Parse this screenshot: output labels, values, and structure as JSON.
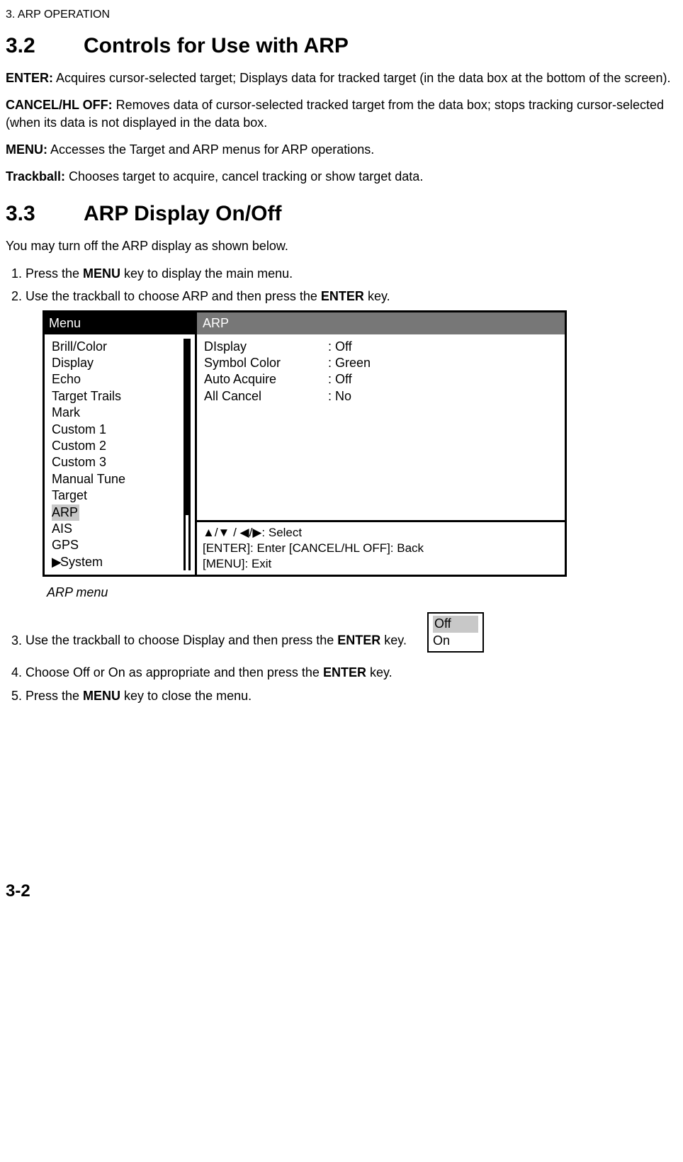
{
  "header": {
    "chapter": "3. ARP OPERATION"
  },
  "section32": {
    "num": "3.2",
    "title": "Controls for Use with ARP",
    "p_enter_label": "ENTER:",
    "p_enter_text": " Acquires cursor-selected target; Displays data for tracked target (in the data box at the bottom of the screen).",
    "p_cancel_label": "CANCEL/HL OFF:",
    "p_cancel_text": " Removes data of cursor-selected tracked target from the data box; stops tracking cursor-selected (when its data is not displayed in the data box.",
    "p_menu_label": "MENU:",
    "p_menu_text": " Accesses the Target and ARP menus for ARP operations.",
    "p_trackball_label": "Trackball:",
    "p_trackball_text": " Chooses target to acquire, cancel tracking or show target data."
  },
  "section33": {
    "num": "3.3",
    "title": "ARP Display On/Off",
    "intro": "You may turn off the ARP display as shown below.",
    "step1_a": "Press the ",
    "step1_b": "MENU",
    "step1_c": " key to display the main menu.",
    "step2_a": "Use the trackball to choose ARP and then press the ",
    "step2_b": "ENTER",
    "step2_c": " key.",
    "step3_a": "Use the trackball to choose Display and then press the ",
    "step3_b": "ENTER",
    "step3_c": " key.",
    "step4_a": "Choose Off or On as appropriate and then press the ",
    "step4_b": "ENTER",
    "step4_c": " key.",
    "step5_a": "Press the ",
    "step5_b": "MENU",
    "step5_c": " key to close the menu."
  },
  "menu_figure": {
    "left_title": "Menu",
    "items": {
      "i0": "Brill/Color",
      "i1": "Display",
      "i2": "Echo",
      "i3": "Target Trails",
      "i4": "Mark",
      "i5": "Custom 1",
      "i6": "Custom 2",
      "i7": "Custom 3",
      "i8": "Manual Tune",
      "i9": "Target",
      "i10": "ARP",
      "i11": "AIS",
      "i12": "GPS",
      "i13_arrow": "▶",
      "i13_label": "System"
    },
    "right_title": "ARP",
    "options": {
      "o0": {
        "label": "DIsplay",
        "value": ": Off"
      },
      "o1": {
        "label": "Symbol Color",
        "value": ": Green"
      },
      "o2": {
        "label": "Auto Acquire",
        "value": ": Off"
      },
      "o3": {
        "label": "All Cancel",
        "value": ": No"
      }
    },
    "footer": {
      "l1": "▲/▼ / ◀/▶: Select",
      "l2": "[ENTER]: Enter  [CANCEL/HL OFF]: Back",
      "l3": "[MENU]: Exit"
    },
    "caption": "ARP menu"
  },
  "option_box": {
    "off": "Off",
    "on": "On"
  },
  "page_number": "3-2"
}
